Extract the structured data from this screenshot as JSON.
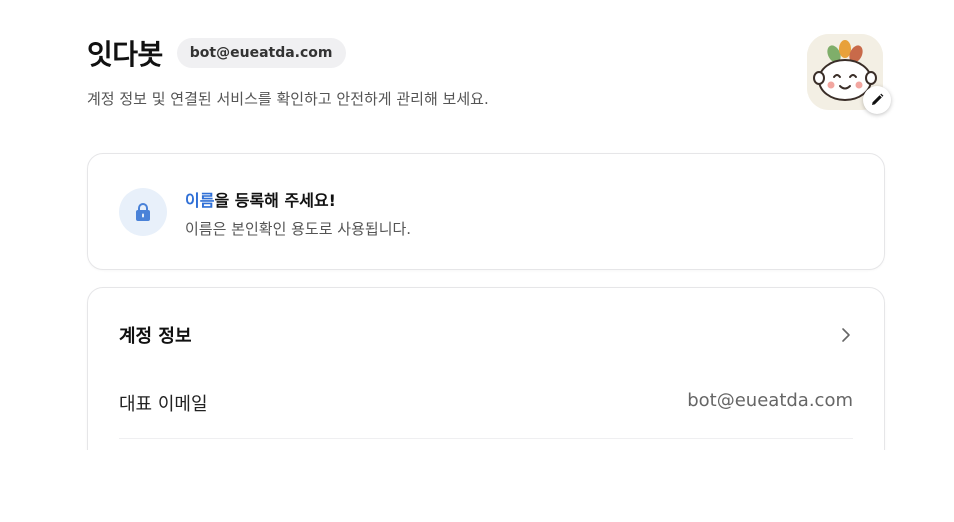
{
  "header": {
    "title": "잇다봇",
    "email_badge": "bot@eueatda.com",
    "subtitle": "계정 정보 및 연결된 서비스를 확인하고 안전하게 관리해 보세요."
  },
  "notice": {
    "title_highlight": "이름",
    "title_rest": "을 등록해 주세요!",
    "description": "이름은 본인확인 용도로 사용됩니다."
  },
  "account_section": {
    "title": "계정 정보",
    "rows": [
      {
        "label": "대표 이메일",
        "value": "bot@eueatda.com"
      }
    ]
  },
  "colors": {
    "accent": "#2f6fd6",
    "lock_bg": "#e8f0fa"
  },
  "icons": {
    "lock": "lock-icon",
    "edit": "pencil-icon",
    "chevron": "chevron-right-icon",
    "avatar": "mascot-avatar"
  }
}
